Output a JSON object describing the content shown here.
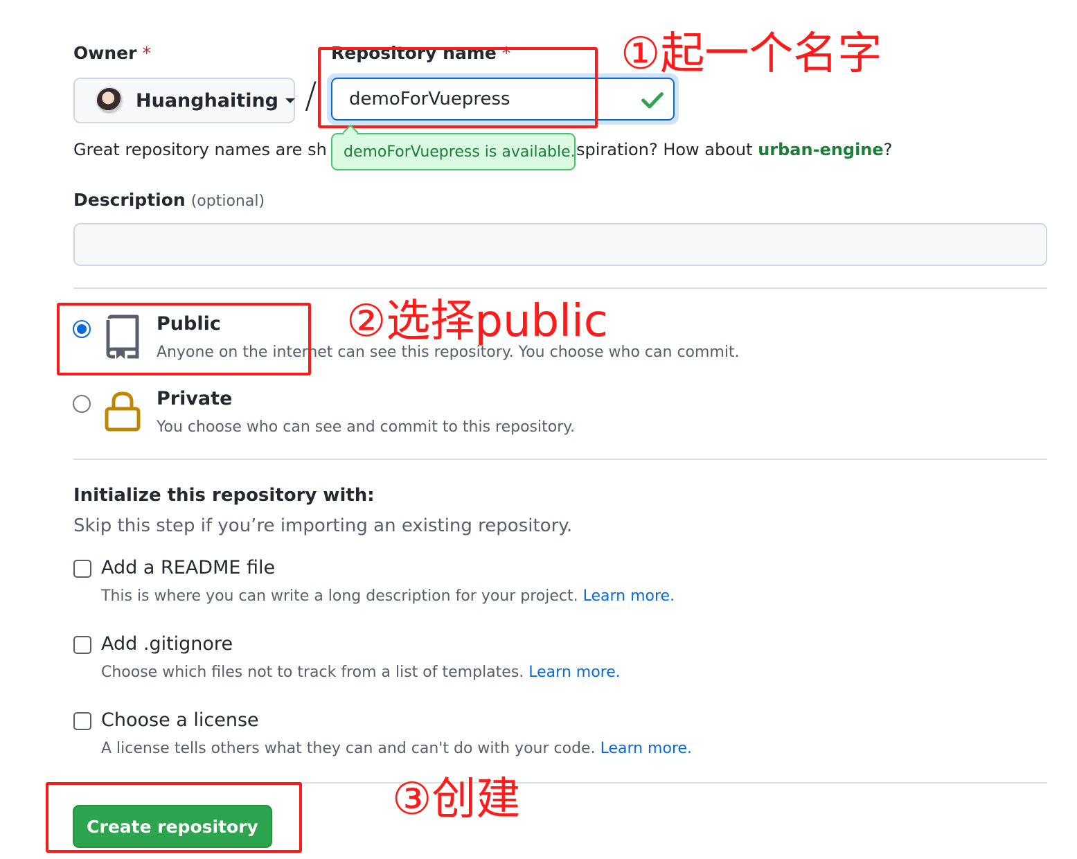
{
  "owner": {
    "label": "Owner",
    "required_mark": "*",
    "name": "Huanghaiting"
  },
  "separator": "/",
  "repo": {
    "label": "Repository name",
    "required_mark": "*",
    "value": "demoForVuepress",
    "availability_tip": "demoForVuepress is available.",
    "hint_prefix": "Great repository names are sh",
    "hint_middle": "spiration? How about ",
    "hint_suggestion": "urban-engine",
    "hint_suffix": "?"
  },
  "description": {
    "label": "Description",
    "optional": "(optional)"
  },
  "visibility": {
    "public": {
      "title": "Public",
      "desc": "Anyone on the internet can see this repository. You choose who can commit.",
      "selected": true
    },
    "private": {
      "title": "Private",
      "desc": "You choose who can see and commit to this repository.",
      "selected": false
    }
  },
  "initialize": {
    "title": "Initialize this repository with:",
    "subtitle": "Skip this step if you’re importing an existing repository.",
    "options": [
      {
        "title": "Add a README file",
        "desc": "This is where you can write a long description for your project. ",
        "link": "Learn more."
      },
      {
        "title": "Add .gitignore",
        "desc": "Choose which files not to track from a list of templates. ",
        "link": "Learn more."
      },
      {
        "title": "Choose a license",
        "desc": "A license tells others what they can and can't do with your code. ",
        "link": "Learn more."
      }
    ]
  },
  "create_button": "Create repository",
  "annotations": {
    "step1": "①起一个名字",
    "step2": "②选择public",
    "step3": "③创建"
  },
  "colors": {
    "primary_button": "#2da44e",
    "link_blue": "#0969da",
    "success_green": "#1a7f37",
    "annotation_red": "#ff1a1a",
    "private_lock": "#bf8700"
  }
}
